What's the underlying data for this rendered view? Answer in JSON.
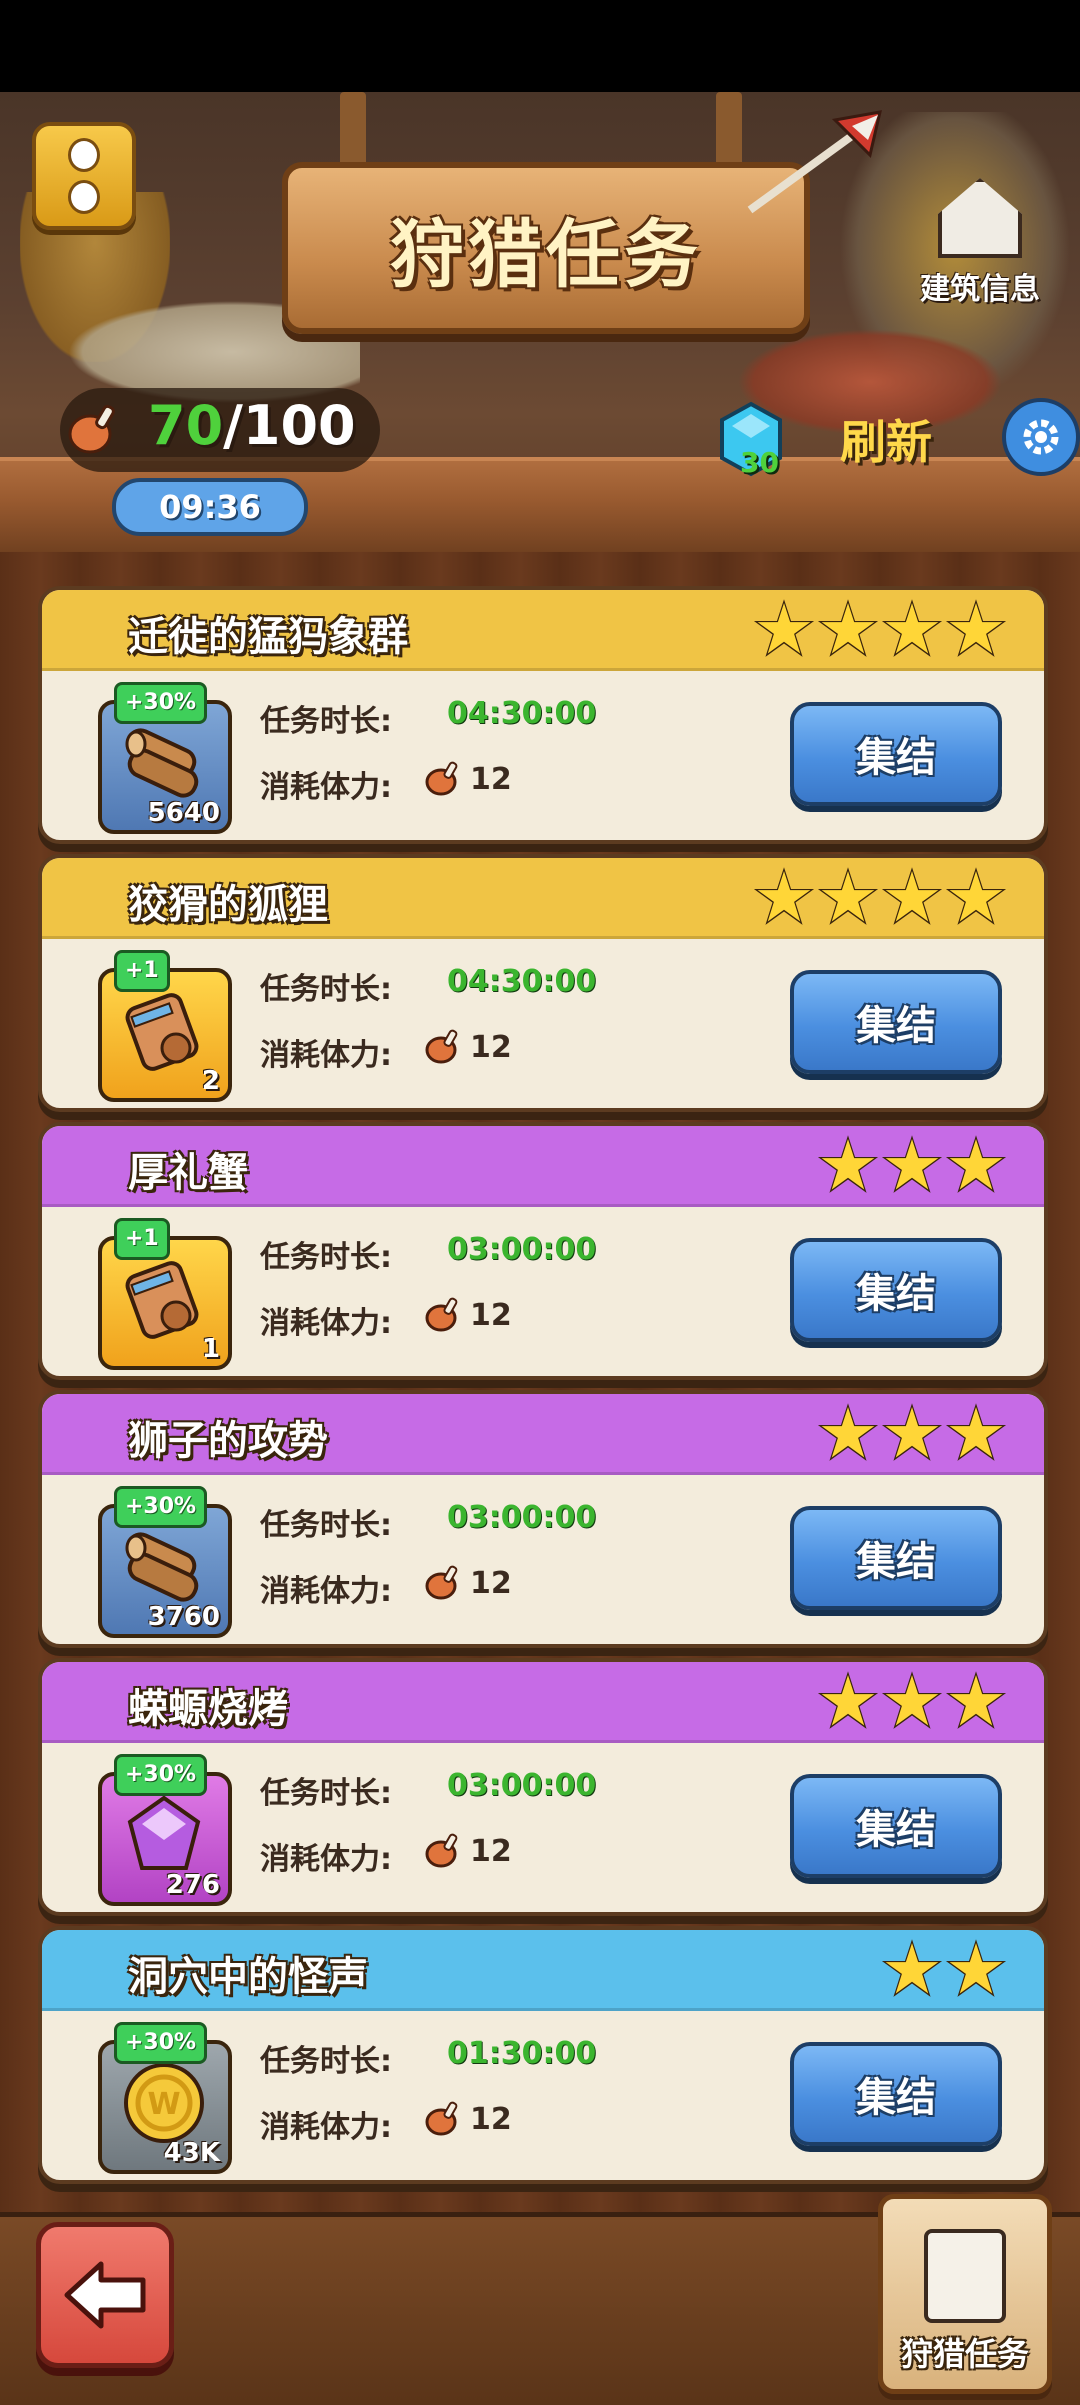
{
  "header": {
    "title": "狩猎任务",
    "building_info_label": "建筑信息",
    "stamina_current": "70",
    "stamina_max": "/100",
    "timer": "09:36",
    "gem_count": "30",
    "refresh_label": "刷新"
  },
  "labels": {
    "duration": "任务时长:",
    "cost": "消耗体力:",
    "gather": "集结"
  },
  "missions": [
    {
      "title": "迁徙的猛犸象群",
      "stars": 4,
      "color": "#f0c445",
      "reward": "wood",
      "badge": "+30%",
      "count": "5640",
      "duration": "04:30:00",
      "cost": "12"
    },
    {
      "title": "狡猾的狐狸",
      "stars": 4,
      "color": "#f0c445",
      "reward": "scroll",
      "badge": "+1",
      "count": "2",
      "duration": "04:30:00",
      "cost": "12"
    },
    {
      "title": "厚礼蟹",
      "stars": 3,
      "color": "#c66be6",
      "reward": "scroll",
      "badge": "+1",
      "count": "1",
      "duration": "03:00:00",
      "cost": "12"
    },
    {
      "title": "狮子的攻势",
      "stars": 3,
      "color": "#c66be6",
      "reward": "wood",
      "badge": "+30%",
      "count": "3760",
      "duration": "03:00:00",
      "cost": "12"
    },
    {
      "title": "蝾螈烧烤",
      "stars": 3,
      "color": "#c66be6",
      "reward": "crystal",
      "badge": "+30%",
      "count": "276",
      "duration": "03:00:00",
      "cost": "12"
    },
    {
      "title": "洞穴中的怪声",
      "stars": 2,
      "color": "#5bc0ec",
      "reward": "coin",
      "badge": "+30%",
      "count": "43K",
      "duration": "01:30:00",
      "cost": "12"
    }
  ],
  "footer": {
    "hunt_tab_label": "狩猎任务"
  }
}
